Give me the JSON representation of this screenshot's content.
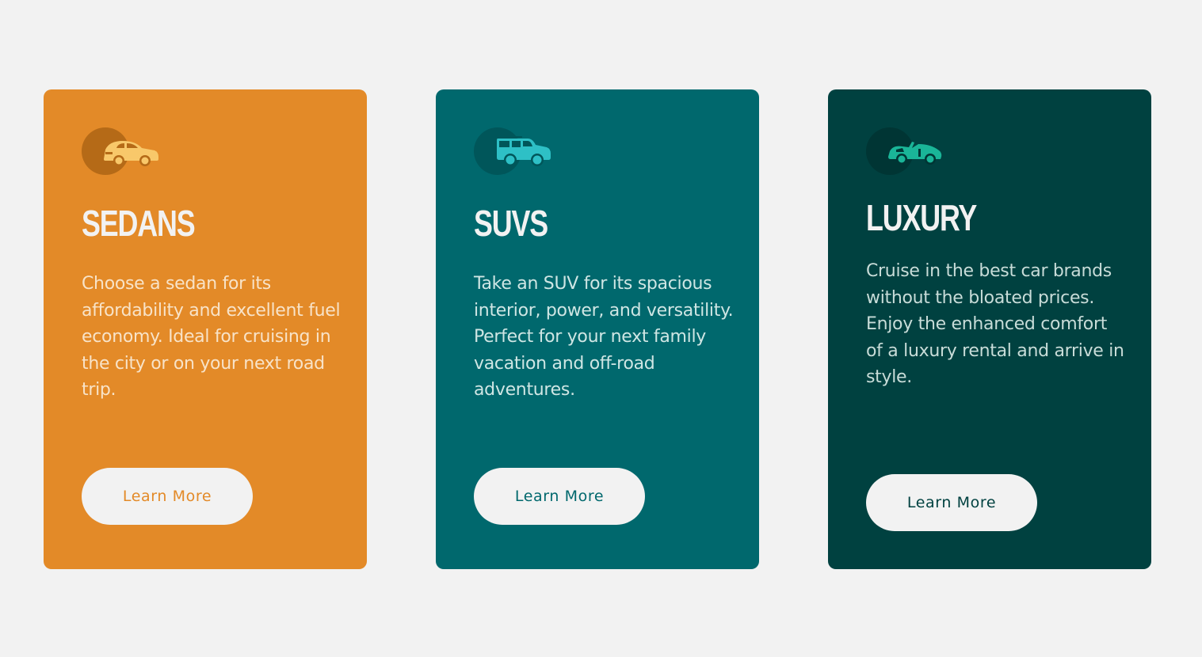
{
  "cards": [
    {
      "title": "SEDANS",
      "description": "Choose a sedan for its affordability and excellent fuel economy. Ideal for cruising in the city or on your next road trip.",
      "button_label": "Learn More",
      "icon": "sedan-car-icon",
      "colors": {
        "background": "#e38a28",
        "icon_circle": "#b56a17",
        "icon": "#f8c86a",
        "text": "#f8e3c8",
        "button_text": "#e38a28"
      }
    },
    {
      "title": "SUVS",
      "description": "Take an SUV for its spacious interior, power, and versatility. Perfect for your next family vacation and off-road adventures.",
      "button_label": "Learn More",
      "icon": "suv-car-icon",
      "colors": {
        "background": "#00686d",
        "icon_circle": "#00565a",
        "icon": "#2ec0c6",
        "text": "#cfe6e4",
        "button_text": "#00686d"
      }
    },
    {
      "title": "LUXURY",
      "description": "Cruise in the best car brands without the bloated prices. Enjoy the enhanced comfort of a luxury rental and arrive in style.",
      "button_label": "Learn More",
      "icon": "convertible-car-icon",
      "colors": {
        "background": "#004140",
        "icon_circle": "#003534",
        "icon": "#1ab598",
        "text": "#c8dcd8",
        "button_text": "#004140"
      }
    }
  ]
}
